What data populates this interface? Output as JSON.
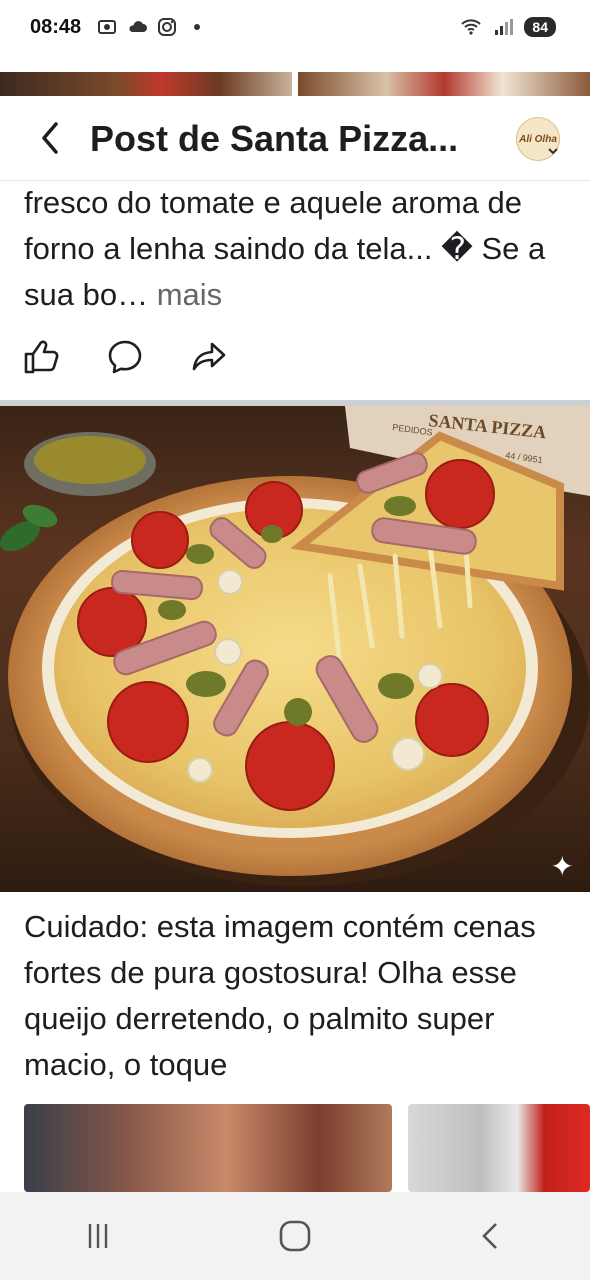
{
  "status_bar": {
    "time": "08:48",
    "battery": "84",
    "icons_left": [
      "screen-record-icon",
      "cloud-icon",
      "instagram-icon",
      "dot-icon"
    ],
    "icons_right": [
      "wifi-icon",
      "signal-icon",
      "battery-icon"
    ]
  },
  "header": {
    "title": "Post de Santa Pizza...",
    "avatar_text": "Ali Olha"
  },
  "post": {
    "caption_top": "fresco do tomate e aquele aroma de forno a lenha saindo da tela... � Se a sua bo…",
    "more_label": "mais",
    "caption_bottom": "Cuidado: esta imagem contém cenas fortes de pura gostosura! Olha esse queijo derretendo, o palmito super macio, o toque",
    "image_text": {
      "box_brand": "SANTA PIZZA",
      "box_sub": "PEDIDOS",
      "box_phone": "44 / 9951"
    }
  },
  "actions": [
    "like-icon",
    "comment-icon",
    "share-icon"
  ],
  "nav": [
    "recent-apps-icon",
    "home-icon",
    "back-nav-icon"
  ],
  "colors": {
    "text": "#1c1e21",
    "muted": "#65676b",
    "divider": "#ccd0d5"
  }
}
